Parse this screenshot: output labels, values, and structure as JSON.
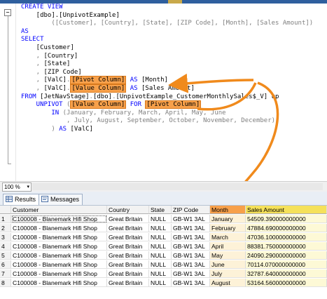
{
  "editor": {
    "lines": [
      [
        {
          "t": "CREATE VIEW",
          "c": "kw"
        }
      ],
      [
        {
          "t": "    [dbo].[UnpivotExample]"
        }
      ],
      [
        {
          "t": "        ([Customer], [Country], [State], [ZIP Code], [Month], [Sales Amount])",
          "c": "gr"
        }
      ],
      [
        {
          "t": "AS",
          "c": "kw"
        }
      ],
      [
        {
          "t": "SELECT",
          "c": "kw"
        }
      ],
      [
        {
          "t": "    [Customer]"
        }
      ],
      [
        {
          "t": "    , ",
          "c": "gr"
        },
        {
          "t": "[Country]"
        }
      ],
      [
        {
          "t": "    , ",
          "c": "gr"
        },
        {
          "t": "[State]"
        }
      ],
      [
        {
          "t": "    , ",
          "c": "gr"
        },
        {
          "t": "[ZIP Code]"
        }
      ],
      [
        {
          "t": "    , ",
          "c": "gr"
        },
        {
          "t": "[ValC]"
        },
        {
          "t": ".",
          "c": "gr"
        },
        {
          "t": "[Pivot Column]",
          "c": "hl"
        },
        {
          "t": " AS ",
          "c": "kw"
        },
        {
          "t": "[Month]"
        }
      ],
      [
        {
          "t": "    , ",
          "c": "gr"
        },
        {
          "t": "[ValC]"
        },
        {
          "t": ".",
          "c": "gr"
        },
        {
          "t": "[Value Column]",
          "c": "hl"
        },
        {
          "t": " AS ",
          "c": "kw"
        },
        {
          "t": "[Sales Amount]"
        }
      ],
      [
        {
          "t": "FROM ",
          "c": "kw"
        },
        {
          "t": "[JetNavStage]"
        },
        {
          "t": ".",
          "c": "gr"
        },
        {
          "t": "[dbo]"
        },
        {
          "t": ".",
          "c": "gr"
        },
        {
          "t": "[UnpivotExample_CustomerMonthlySales$_V] up"
        }
      ],
      [
        {
          "t": "    UNPIVOT ",
          "c": "kw"
        },
        {
          "t": "(",
          "c": "gr"
        },
        {
          "t": "[Value Column]",
          "c": "hl"
        },
        {
          "t": " FOR ",
          "c": "kw"
        },
        {
          "t": "[Pivot Column]",
          "c": "hl"
        }
      ],
      [
        {
          "t": "        IN ",
          "c": "kw"
        },
        {
          "t": "(January, February, March, April, May, June",
          "c": "gr"
        }
      ],
      [
        {
          "t": "            , July, August, September, October, November, December)",
          "c": "gr"
        }
      ],
      [
        {
          "t": "        ) ",
          "c": "gr"
        },
        {
          "t": "AS ",
          "c": "kw"
        },
        {
          "t": "[ValC]"
        }
      ]
    ],
    "fold_glyph": "−"
  },
  "zoom": {
    "value": "100 %",
    "arrow": "▾"
  },
  "tabs": [
    {
      "label": "Results",
      "icon": "results-grid-icon",
      "active": true
    },
    {
      "label": "Messages",
      "icon": "messages-icon",
      "active": false
    }
  ],
  "grid": {
    "columns": [
      "",
      "Customer",
      "Country",
      "State",
      "ZIP Code",
      "Month",
      "Sales Amount"
    ],
    "rows": [
      [
        "1",
        "C100008 - Blanemark Hifi Shop",
        "Great Britain",
        "NULL",
        "GB-W1 3AL",
        "January",
        "54509.390000000000"
      ],
      [
        "2",
        "C100008 - Blanemark Hifi Shop",
        "Great Britain",
        "NULL",
        "GB-W1 3AL",
        "February",
        "47884.690000000000"
      ],
      [
        "3",
        "C100008 - Blanemark Hifi Shop",
        "Great Britain",
        "NULL",
        "GB-W1 3AL",
        "March",
        "47036.100000000000"
      ],
      [
        "4",
        "C100008 - Blanemark Hifi Shop",
        "Great Britain",
        "NULL",
        "GB-W1 3AL",
        "April",
        "88381.750000000000"
      ],
      [
        "5",
        "C100008 - Blanemark Hifi Shop",
        "Great Britain",
        "NULL",
        "GB-W1 3AL",
        "May",
        "24090.290000000000"
      ],
      [
        "6",
        "C100008 - Blanemark Hifi Shop",
        "Great Britain",
        "NULL",
        "GB-W1 3AL",
        "June",
        "70114.070000000000"
      ],
      [
        "7",
        "C100008 - Blanemark Hifi Shop",
        "Great Britain",
        "NULL",
        "GB-W1 3AL",
        "July",
        "32787.640000000000"
      ],
      [
        "8",
        "C100008 - Blanemark Hifi Shop",
        "Great Britain",
        "NULL",
        "GB-W1 3AL",
        "August",
        "53164.560000000000"
      ]
    ]
  },
  "colors": {
    "keyword": "#0000ff",
    "highlight": "#f7a04a",
    "arrow": "#f08a1c",
    "month_header": "#f7a04a",
    "amount_header": "#f5e15a"
  }
}
